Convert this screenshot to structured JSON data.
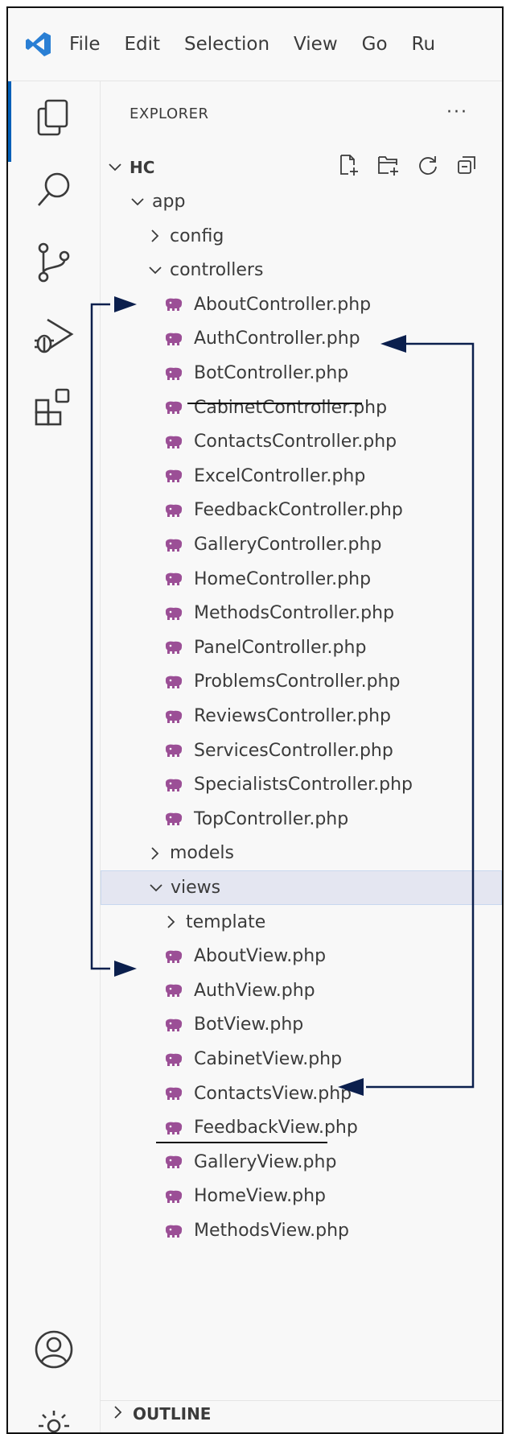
{
  "menu": [
    "File",
    "Edit",
    "Selection",
    "View",
    "Go",
    "Ru"
  ],
  "activity_bar": [
    "explorer-icon",
    "search-icon",
    "source-control-icon",
    "run-debug-icon",
    "extensions-icon",
    "account-icon",
    "settings-gear-icon"
  ],
  "explorer": {
    "title": "EXPLORER",
    "more": "···",
    "root": "HC",
    "tree": [
      {
        "label": "app",
        "indent": 1,
        "type": "folder",
        "expanded": true
      },
      {
        "label": "config",
        "indent": 2,
        "type": "folder",
        "expanded": false
      },
      {
        "label": "controllers",
        "indent": 2,
        "type": "folder",
        "expanded": true
      },
      {
        "label": "AboutController.php",
        "indent": 3,
        "type": "php"
      },
      {
        "label": "AuthController.php",
        "indent": 3,
        "type": "php"
      },
      {
        "label": "BotController.php",
        "indent": 3,
        "type": "php"
      },
      {
        "label": "CabinetController.php",
        "indent": 3,
        "type": "php"
      },
      {
        "label": "ContactsController.php",
        "indent": 3,
        "type": "php"
      },
      {
        "label": "ExcelController.php",
        "indent": 3,
        "type": "php"
      },
      {
        "label": "FeedbackController.php",
        "indent": 3,
        "type": "php"
      },
      {
        "label": "GalleryController.php",
        "indent": 3,
        "type": "php"
      },
      {
        "label": "HomeController.php",
        "indent": 3,
        "type": "php"
      },
      {
        "label": "MethodsController.php",
        "indent": 3,
        "type": "php"
      },
      {
        "label": "PanelController.php",
        "indent": 3,
        "type": "php"
      },
      {
        "label": "ProblemsController.php",
        "indent": 3,
        "type": "php"
      },
      {
        "label": "ReviewsController.php",
        "indent": 3,
        "type": "php"
      },
      {
        "label": "ServicesController.php",
        "indent": 3,
        "type": "php"
      },
      {
        "label": "SpecialistsController.php",
        "indent": 3,
        "type": "php"
      },
      {
        "label": "TopController.php",
        "indent": 3,
        "type": "php"
      },
      {
        "label": "models",
        "indent": 2,
        "type": "folder",
        "expanded": false
      },
      {
        "label": "views",
        "indent": 2,
        "type": "folder",
        "expanded": true,
        "selected": true
      },
      {
        "label": "template",
        "indent": 3,
        "type": "folder",
        "expanded": false
      },
      {
        "label": "AboutView.php",
        "indent": 3,
        "type": "php"
      },
      {
        "label": "AuthView.php",
        "indent": 3,
        "type": "php"
      },
      {
        "label": "BotView.php",
        "indent": 3,
        "type": "php"
      },
      {
        "label": "CabinetView.php",
        "indent": 3,
        "type": "php"
      },
      {
        "label": "ContactsView.php",
        "indent": 3,
        "type": "php"
      },
      {
        "label": "FeedbackView.php",
        "indent": 3,
        "type": "php"
      },
      {
        "label": "GalleryView.php",
        "indent": 3,
        "type": "php"
      },
      {
        "label": "HomeView.php",
        "indent": 3,
        "type": "php"
      },
      {
        "label": "MethodsView.php",
        "indent": 3,
        "type": "php"
      }
    ]
  },
  "outline": "OUTLINE",
  "colors": {
    "accent": "#005fb8",
    "php_icon": "#9b4f96",
    "arrow": "#0b1f4d",
    "selected_row": "#e4e6f1",
    "vscode_logo": "#2a7fd4"
  }
}
